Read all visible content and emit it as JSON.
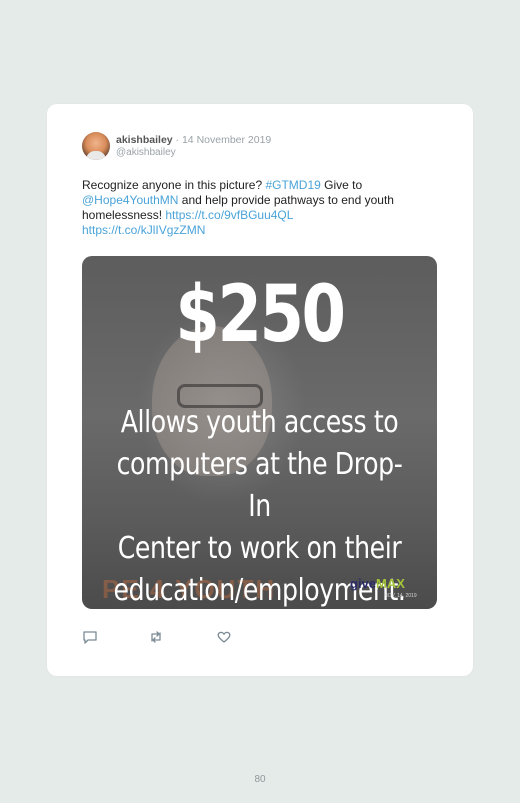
{
  "tweet": {
    "display_name": "akishbailey",
    "separator": "·",
    "date": "14 November 2019",
    "handle": "@akishbailey",
    "text": {
      "part1": "Recognize anyone in this picture? ",
      "hashtag": "#GTMD19",
      "part2": " Give to ",
      "mention": "@Hope4YouthMN",
      "part3": " and help provide pathways to end youth homelessness! ",
      "link1": "https://t.co/9vfBGuu4QL",
      "link2": "https://t.co/kJlIVgzZMN"
    }
  },
  "media": {
    "amount": "$250",
    "message_lines": [
      "Allows youth access to",
      "computers at the Drop-In",
      "Center to work on their",
      "education/employment."
    ],
    "logo_give": "give",
    "logo_max": "MAX",
    "logo_date": "NOV. 14, 2019"
  },
  "actions": {
    "reply_icon": "reply-icon",
    "retweet_icon": "retweet-icon",
    "like_icon": "heart-icon"
  },
  "page": {
    "number": "80"
  },
  "colors": {
    "background": "#e5ebe9",
    "link": "#4aa3d8",
    "logo_green": "#a3c43a"
  }
}
